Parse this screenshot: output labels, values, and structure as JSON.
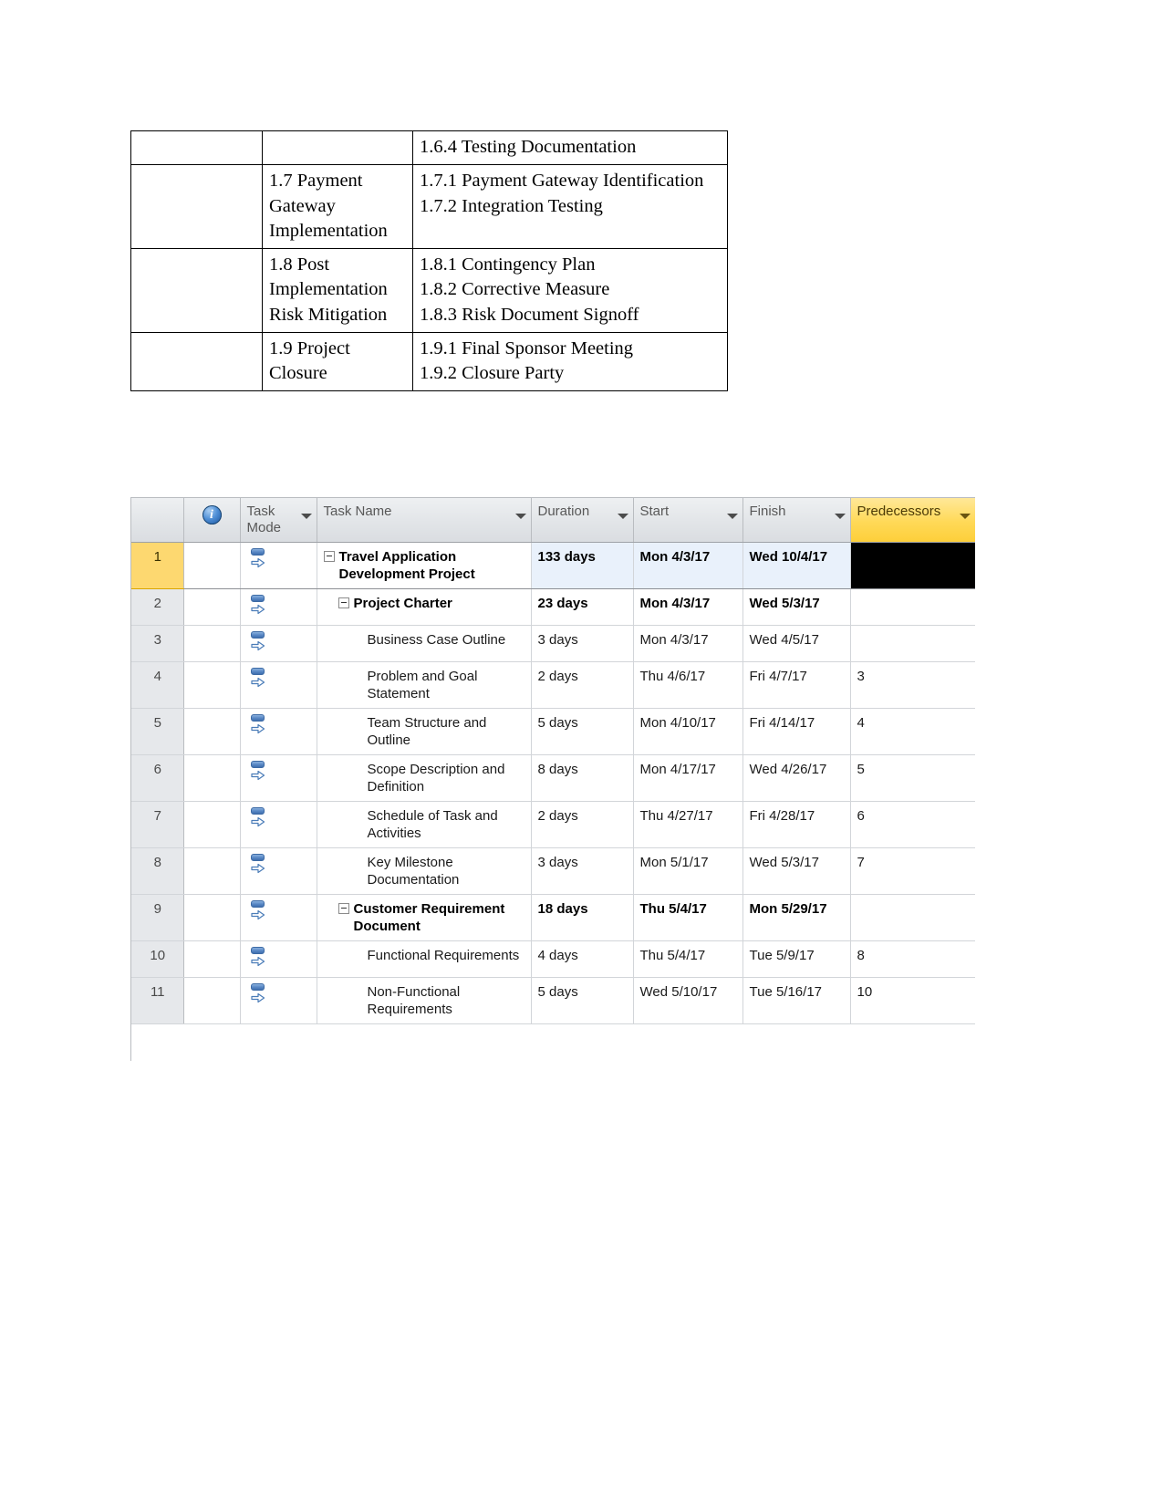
{
  "wbs_table": {
    "rows": [
      {
        "col1": "",
        "col2": "",
        "col3": "1.6.4 Testing Documentation"
      },
      {
        "col1": "",
        "col2": "1.7 Payment Gateway Implementation",
        "col3": "1.7.1 Payment Gateway Identification\n1.7.2 Integration Testing"
      },
      {
        "col1": "",
        "col2": "1.8 Post Implementation Risk Mitigation",
        "col3": "1.8.1 Contingency Plan\n1.8.2 Corrective Measure\n1.8.3 Risk Document Signoff"
      },
      {
        "col1": "",
        "col2": "1.9 Project Closure",
        "col3": "1.9.1 Final Sponsor Meeting\n1.9.2 Closure Party"
      }
    ]
  },
  "project_grid": {
    "columns": {
      "id": "",
      "indicator_icon": "info-icon",
      "task_mode": "Task Mode",
      "task_name": "Task Name",
      "duration": "Duration",
      "start": "Start",
      "finish": "Finish",
      "predecessors": "Predecessors"
    },
    "accent_colors": {
      "predecessor_header": "#ffd957",
      "selected_row_number": "#fdd870",
      "selected_cell_fill": "#e9f1fb",
      "selected_predecessor_cell": "#000000",
      "task_mode_icon": "#4f8fd6"
    },
    "rows": [
      {
        "id": "1",
        "name": "Travel Application Development Project",
        "duration": "133 days",
        "start": "Mon 4/3/17",
        "finish": "Wed 10/4/17",
        "predecessors": "",
        "level": 0,
        "summary": true,
        "selected": true
      },
      {
        "id": "2",
        "name": "Project Charter",
        "duration": "23 days",
        "start": "Mon 4/3/17",
        "finish": "Wed 5/3/17",
        "predecessors": "",
        "level": 1,
        "summary": true,
        "selected": false
      },
      {
        "id": "3",
        "name": "Business Case Outline",
        "duration": "3 days",
        "start": "Mon 4/3/17",
        "finish": "Wed 4/5/17",
        "predecessors": "",
        "level": 2,
        "summary": false,
        "selected": false
      },
      {
        "id": "4",
        "name": "Problem and Goal Statement",
        "duration": "2 days",
        "start": "Thu 4/6/17",
        "finish": "Fri 4/7/17",
        "predecessors": "3",
        "level": 2,
        "summary": false,
        "selected": false
      },
      {
        "id": "5",
        "name": "Team Structure and Outline",
        "duration": "5 days",
        "start": "Mon 4/10/17",
        "finish": "Fri 4/14/17",
        "predecessors": "4",
        "level": 2,
        "summary": false,
        "selected": false
      },
      {
        "id": "6",
        "name": "Scope Description and Definition",
        "duration": "8 days",
        "start": "Mon 4/17/17",
        "finish": "Wed 4/26/17",
        "predecessors": "5",
        "level": 2,
        "summary": false,
        "selected": false
      },
      {
        "id": "7",
        "name": "Schedule of Task and Activities",
        "duration": "2 days",
        "start": "Thu 4/27/17",
        "finish": "Fri 4/28/17",
        "predecessors": "6",
        "level": 2,
        "summary": false,
        "selected": false
      },
      {
        "id": "8",
        "name": "Key Milestone Documentation",
        "duration": "3 days",
        "start": "Mon 5/1/17",
        "finish": "Wed 5/3/17",
        "predecessors": "7",
        "level": 2,
        "summary": false,
        "selected": false
      },
      {
        "id": "9",
        "name": "Customer Requirement Document",
        "duration": "18 days",
        "start": "Thu 5/4/17",
        "finish": "Mon 5/29/17",
        "predecessors": "",
        "level": 1,
        "summary": true,
        "selected": false
      },
      {
        "id": "10",
        "name": "Functional Requirements",
        "duration": "4 days",
        "start": "Thu 5/4/17",
        "finish": "Tue 5/9/17",
        "predecessors": "8",
        "level": 2,
        "summary": false,
        "selected": false
      },
      {
        "id": "11",
        "name": "Non-Functional Requirements",
        "duration": "5 days",
        "start": "Wed 5/10/17",
        "finish": "Tue 5/16/17",
        "predecessors": "10",
        "level": 2,
        "summary": false,
        "selected": false
      }
    ]
  }
}
